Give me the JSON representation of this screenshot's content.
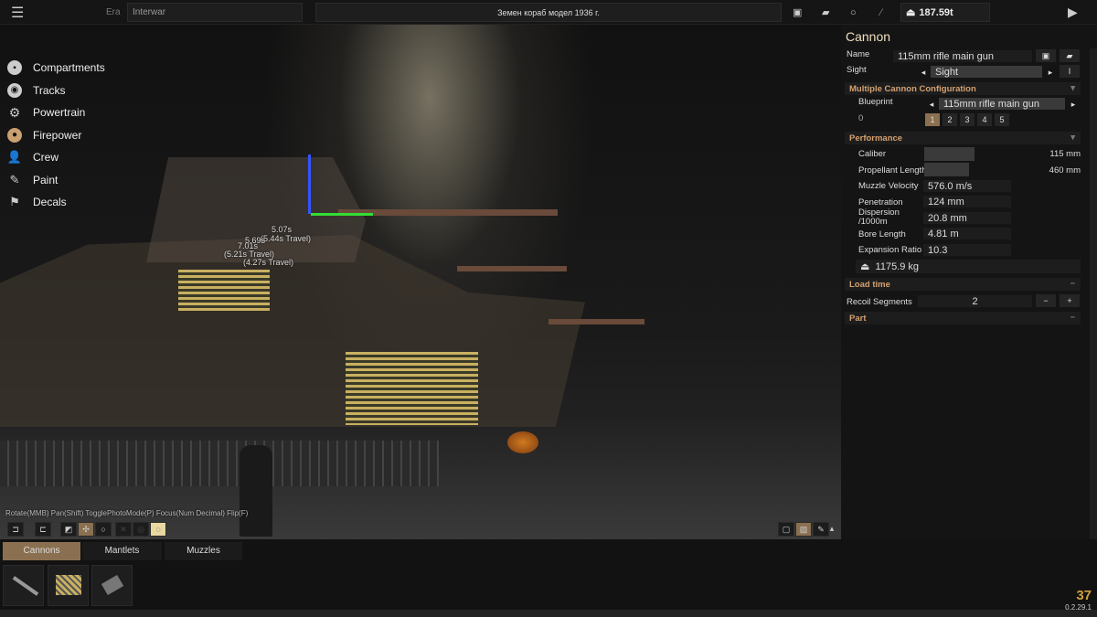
{
  "topbar": {
    "era_label": "Era",
    "era_value": "Interwar",
    "vehicle_name": "Земен кораб модел 1936 г.",
    "weight": "187.59t"
  },
  "left_menu": [
    {
      "label": "Compartments",
      "icon": "cube-icon"
    },
    {
      "label": "Tracks",
      "icon": "track-icon"
    },
    {
      "label": "Powertrain",
      "icon": "gear-icon"
    },
    {
      "label": "Firepower",
      "icon": "cannon-icon"
    },
    {
      "label": "Crew",
      "icon": "person-icon"
    },
    {
      "label": "Paint",
      "icon": "brush-icon"
    },
    {
      "label": "Decals",
      "icon": "decal-icon"
    }
  ],
  "viewport": {
    "labels": [
      "5.07s",
      "(5.44s Travel)",
      "7.01s",
      "5.69s",
      "(5.21s Travel)",
      "(4.27s Travel)"
    ],
    "hint": "Rotate(MMB) Pan(Shift) TogglePhotoMode(P) Focus(Num Decimal) Flip(F)"
  },
  "panel": {
    "title": "Cannon",
    "name_label": "Name",
    "name_value": "115mm rifle main gun",
    "sight_label": "Sight",
    "sight_value": "Sight",
    "sight_btn": "I",
    "mcc": {
      "title": "Multiple Cannon Configuration",
      "blueprint_label": "Blueprint",
      "blueprint_value": "115mm rifle main gun",
      "index_label": "0",
      "counts": [
        "1",
        "2",
        "3",
        "4",
        "5"
      ],
      "selected": "1"
    },
    "performance": {
      "title": "Performance",
      "caliber_label": "Caliber",
      "caliber_value": "115 mm",
      "propellant_label": "Propellant Length",
      "propellant_value": "460 mm",
      "stats": [
        {
          "label": "Muzzle Velocity",
          "value": "576.0 m/s"
        },
        {
          "label": "Penetration",
          "value": "124 mm"
        },
        {
          "label": "Dispersion /1000m",
          "value": "20.8 mm"
        },
        {
          "label": "Bore Length",
          "value": "4.81 m"
        },
        {
          "label": "Expansion Ratio",
          "value": "10.3"
        }
      ],
      "mass": "1175.9 kg"
    },
    "load_time": "Load time",
    "recoil_label": "Recoil Segments",
    "recoil_value": "2",
    "minus": "−",
    "plus": "+",
    "part": "Part"
  },
  "bottom": {
    "tabs": [
      "Cannons",
      "Mantlets",
      "Muzzles"
    ],
    "active_tab": "Cannons",
    "fps": "37",
    "version": "0.2.29.1"
  }
}
